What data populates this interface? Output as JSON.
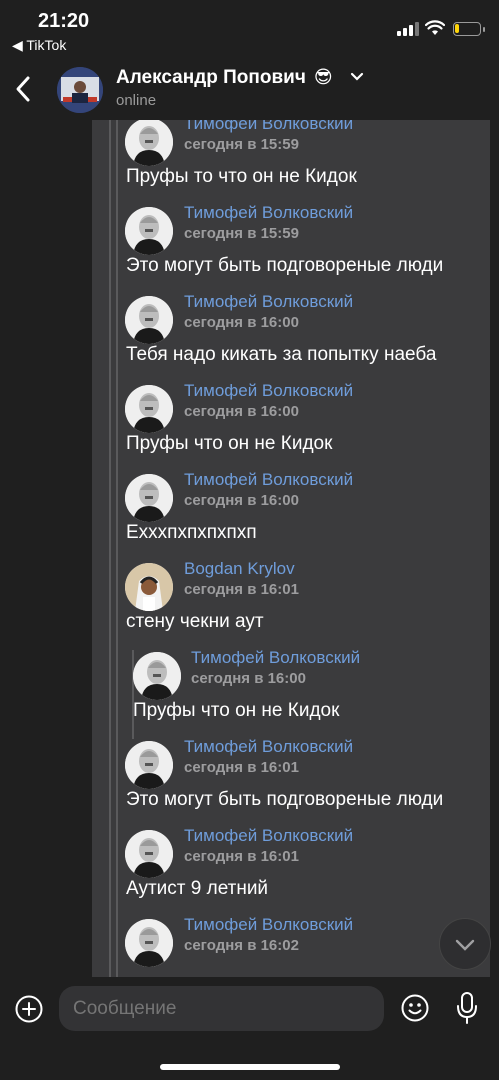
{
  "status_bar": {
    "time": "21:20",
    "back_app": "◀ TikTok",
    "battery_level": 0.2,
    "battery_color": "#ffd60a"
  },
  "header": {
    "name": "Александр Попович",
    "emoji": "😎",
    "status": "online",
    "icons": [
      "back-icon",
      "chevron-down-icon"
    ]
  },
  "messages": [
    {
      "name": "Тимофей Волковский",
      "time": "сегодня в 15:59",
      "text": "Пруфы то что он не Кидок"
    },
    {
      "name": "Тимофей Волковский",
      "time": "сегодня в 15:59",
      "text": "Это могут быть подговореные люди"
    },
    {
      "name": "Тимофей Волковский",
      "time": "сегодня в 16:00",
      "text": "Тебя надо кикать за попытку наеба"
    },
    {
      "name": "Тимофей Волковский",
      "time": "сегодня в 16:00",
      "text": "Пруфы что он не Кидок"
    },
    {
      "name": "Тимофей Волковский",
      "time": "сегодня в 16:00",
      "text": "Ехххпхпхпхпхп"
    },
    {
      "name": "Bogdan Krylov",
      "time": "сегодня в 16:01",
      "text": "стену чекни аут"
    },
    {
      "name": "Тимофей Волковский",
      "time": "сегодня в 16:00",
      "text": "Пруфы что он не Кидок"
    },
    {
      "name": "Тимофей Волковский",
      "time": "сегодня в 16:01",
      "text": "Это могут быть подговореные люди"
    },
    {
      "name": "Тимофей Волковский",
      "time": "сегодня в 16:01",
      "text": "Аутист 9 летний"
    },
    {
      "name": "Тимофей Волковский",
      "time": "сегодня в 16:02",
      "text": ""
    }
  ],
  "composer": {
    "placeholder": "Сообщение",
    "icons": [
      "plus-icon",
      "emoji-icon",
      "mic-icon"
    ]
  },
  "colors": {
    "background": "#1f1f1f",
    "bubble": "#3b3b3d",
    "name_link": "#6f9ddb",
    "muted": "#9d9d9f"
  }
}
